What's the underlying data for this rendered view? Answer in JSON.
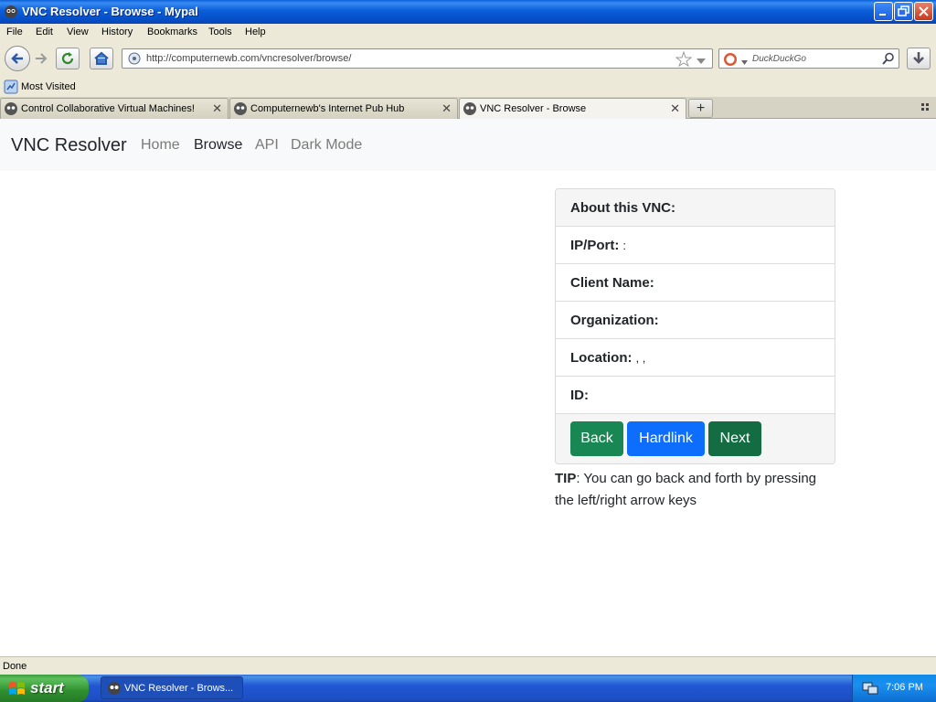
{
  "window": {
    "title": "VNC Resolver - Browse - Mypal"
  },
  "menu": [
    "File",
    "Edit",
    "View",
    "History",
    "Bookmarks",
    "Tools",
    "Help"
  ],
  "navbar": {
    "url": "http://computernewb.com/vncresolver/browse/",
    "search_placeholder": "DuckDuckGo"
  },
  "bookmarks": {
    "most_visited": "Most Visited"
  },
  "tabs": [
    {
      "label": "Control Collaborative Virtual Machines!"
    },
    {
      "label": "Computernewb's Internet Pub Hub"
    },
    {
      "label": "VNC Resolver - Browse"
    }
  ],
  "site": {
    "brand": "VNC Resolver",
    "nav": [
      "Home",
      "Browse",
      "API",
      "Dark Mode"
    ]
  },
  "card": {
    "header": "About this VNC:",
    "rows": [
      {
        "label": "IP/Port:",
        "value": ":"
      },
      {
        "label": "Client Name:",
        "value": ""
      },
      {
        "label": "Organization:",
        "value": ""
      },
      {
        "label": "Location:",
        "value": ", ,"
      },
      {
        "label": "ID:",
        "value": ""
      }
    ],
    "buttons": {
      "back": "Back",
      "hardlink": "Hardlink",
      "next": "Next"
    }
  },
  "tip": {
    "label": "TIP",
    "text": ": You can go back and forth by pressing the left/right arrow keys"
  },
  "status": {
    "text": "Done"
  },
  "taskbar": {
    "start": "start",
    "item": "VNC Resolver - Brows...",
    "clock": "7:06 PM"
  },
  "colors": {
    "back": "#198754",
    "hardlink": "#0d6efd",
    "next": "#146c43"
  }
}
